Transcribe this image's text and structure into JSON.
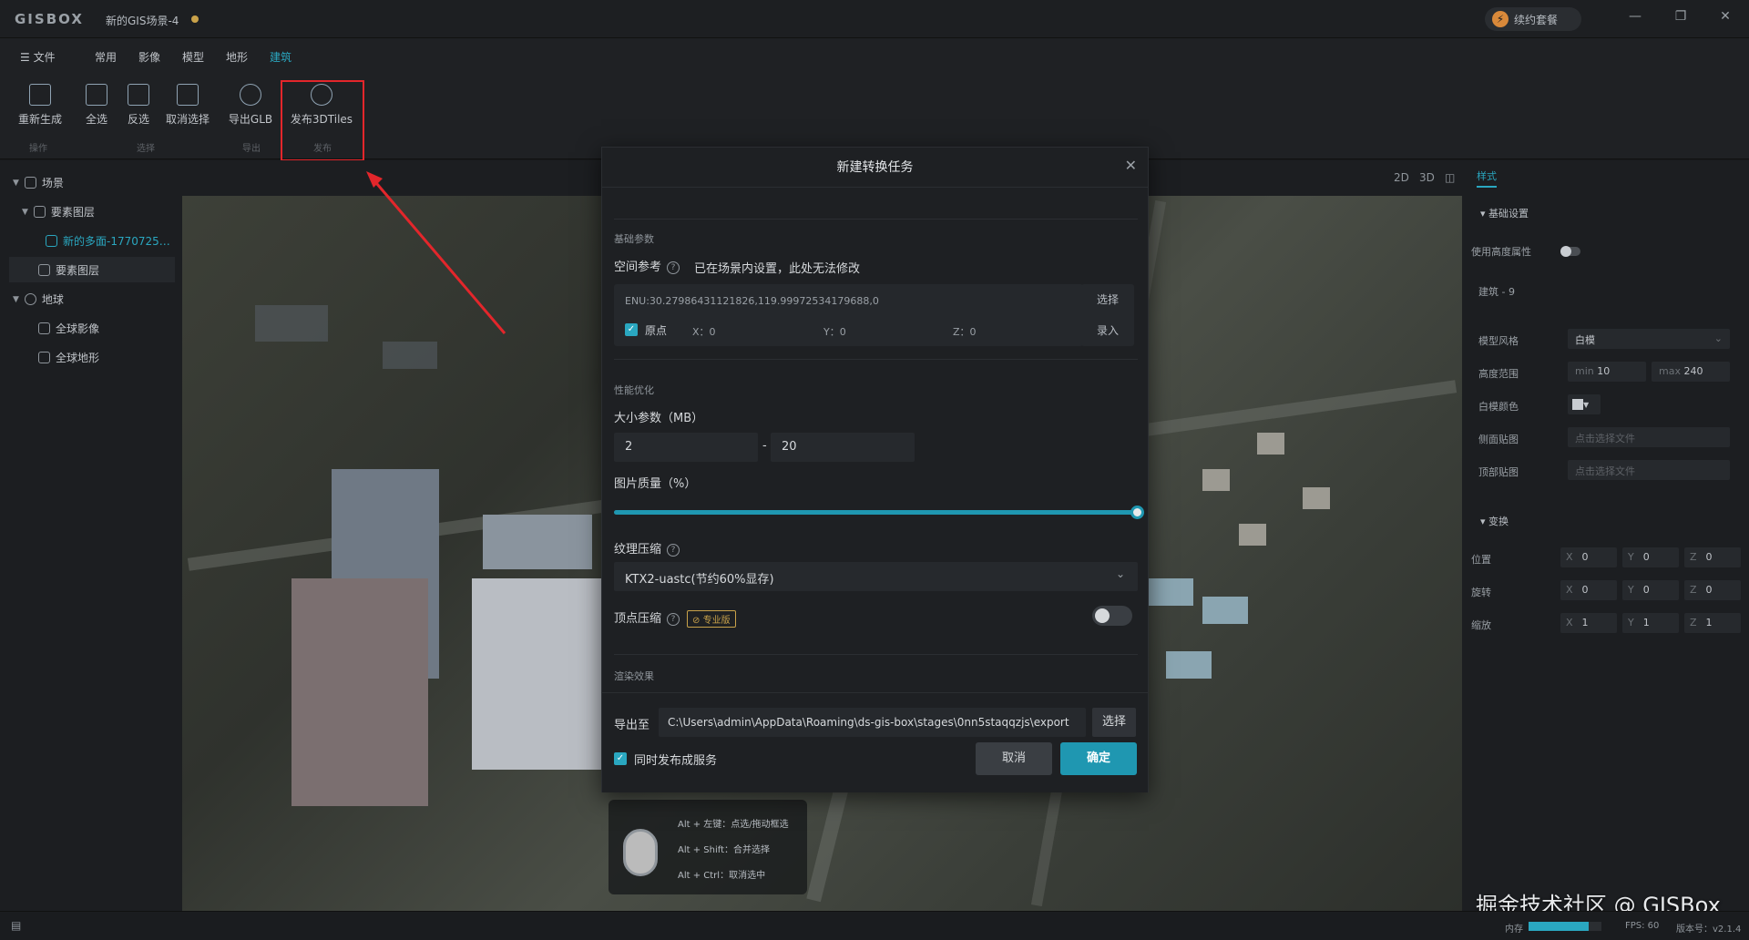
{
  "titlebar": {
    "logo": "GISBOX",
    "doc_title": "新的GIS场景-4",
    "renew_label": "续约套餐",
    "min": "—",
    "restore": "❐",
    "close": "✕"
  },
  "menu": {
    "file": "☰ 文件",
    "items": [
      "常用",
      "影像",
      "模型",
      "地形",
      "建筑"
    ]
  },
  "toolbar": {
    "tools": [
      {
        "label": "重新生成"
      },
      {
        "label": "全选"
      },
      {
        "label": "反选"
      },
      {
        "label": "取消选择"
      },
      {
        "label": "导出GLB"
      },
      {
        "label": "发布3DTiles"
      }
    ],
    "groups": [
      "操作",
      "选择",
      "导出",
      "发布"
    ]
  },
  "tree": {
    "scene": "场景",
    "feature_layer_group": "要素图层",
    "polygon_layer": "新的多面-1770725…",
    "feature_layer": "要素图层",
    "globe": "地球",
    "global_imagery": "全球影像",
    "global_terrain": "全球地形"
  },
  "view": {
    "b2d": "2D",
    "b3d": "3D",
    "split": "◫"
  },
  "right_panel": {
    "tab": "样式",
    "basic_section": "基础设置",
    "use_height_attr": "使用高度属性",
    "layer_name": "建筑 - 9",
    "model_style_label": "模型风格",
    "model_style_value": "白模",
    "height_range_label": "高度范围",
    "min_label": "min",
    "min_value": "10",
    "max_label": "max",
    "max_value": "240",
    "white_color_label": "白模颜色",
    "side_texture_label": "侧面贴图",
    "side_texture_placeholder": "点击选择文件",
    "top_texture_label": "顶部贴图",
    "top_texture_placeholder": "点击选择文件",
    "transform_section": "变换",
    "position_label": "位置",
    "rotation_label": "旋转",
    "scale_label": "缩放",
    "axis_x": "X",
    "axis_y": "Y",
    "axis_z": "Z",
    "position": [
      "0",
      "0",
      "0"
    ],
    "rotation": [
      "0",
      "0",
      "0"
    ],
    "scale": [
      "1",
      "1",
      "1"
    ]
  },
  "hints": {
    "left_click": "Alt + 左键：点选/拖动框选",
    "shift": "Alt + Shift：合并选择",
    "ctrl": "Alt + Ctrl：取消选中"
  },
  "dialog": {
    "title": "新建转换任务",
    "basic_params": "基础参数",
    "spatial_ref": "空间参考",
    "spatial_note": "已在场景内设置，此处无法修改",
    "enu": "ENU:30.27986431121826,119.99972534179688,0",
    "origin": "原点",
    "x_label": "X：0",
    "y_label": "Y：0",
    "z_label": "Z：0",
    "select_btn": "选择",
    "input_btn": "录入",
    "perf_section": "性能优化",
    "size_param": "大小参数（MB）",
    "size_min": "2",
    "size_sep": "-",
    "size_max": "20",
    "img_quality": "图片质量（%）",
    "img_quality_value": 1.0,
    "texture_compress": "纹理压缩",
    "texture_value": "KTX2-uastc(节约60%显存)",
    "vertex_compress": "顶点压缩",
    "pro_badge": "专业版",
    "render_section": "渲染效果",
    "export_to": "导出至",
    "export_path": "C:\\Users\\admin\\AppData\\Roaming\\ds-gis-box\\stages\\0nn5staqqzjs\\export",
    "export_select": "选择",
    "publish_service": "同时发布成服务",
    "cancel": "取消",
    "confirm": "确定"
  },
  "status": {
    "memory": "内存",
    "memory_usage": 0.82,
    "fps": "FPS: 60",
    "version": "版本号：v2.1.4"
  },
  "watermark": "掘金技术社区 @ GISBox",
  "colors": {
    "accent": "#2aa7c0",
    "highlight_box": "#e3262b",
    "warning": "#c9a24a"
  }
}
